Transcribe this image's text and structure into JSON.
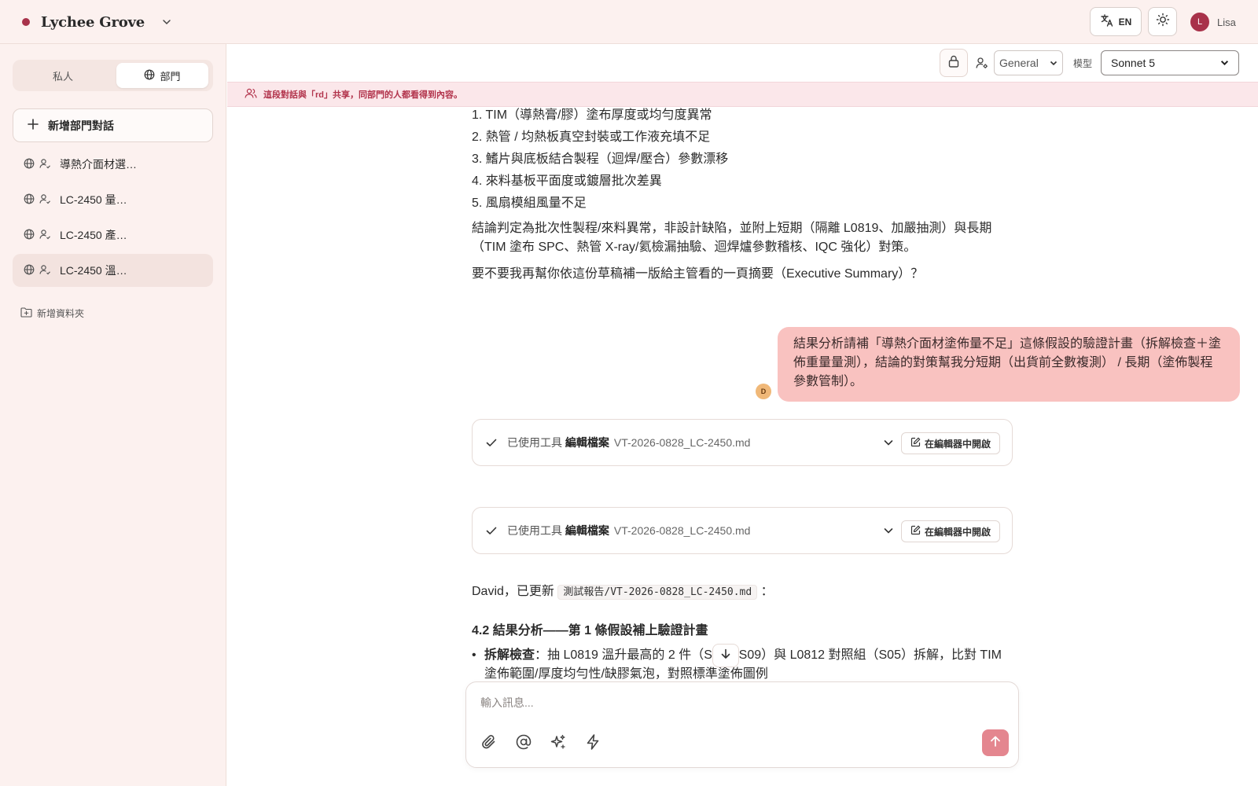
{
  "app": {
    "name": "Lychee Grove",
    "brand_color": "#a8324a",
    "lang_label": "EN",
    "user_initial": "L",
    "user_name": "Lisa"
  },
  "sidebar": {
    "tabs": {
      "private": "私人",
      "department": "部門"
    },
    "new_dept_conversation": "新增部門對話",
    "conversations": [
      {
        "label": "導熱介面材選…",
        "active": false
      },
      {
        "label": "LC-2450 量…",
        "active": false
      },
      {
        "label": "LC-2450 產…",
        "active": false
      },
      {
        "label": "LC-2450 溫…",
        "active": true
      }
    ],
    "new_folder": "新增資料夾"
  },
  "header": {
    "persona_value": "General",
    "model_label": "模型",
    "model_value": "Sonnet 5"
  },
  "banner": {
    "text": "這段對話與「rd」共享，同部門的人都看得到內容。"
  },
  "chat": {
    "list_items": [
      "1. TIM（導熱膏/膠）塗布厚度或均勻度異常",
      "2. 熱管 / 均熱板真空封裝或工作液充填不足",
      "3. 鰭片與底板結合製程（迴焊/壓合）參數漂移",
      "4. 來料基板平面度或鍍層批次差異",
      "5. 風扇模組風量不足"
    ],
    "conclusion_line1": "結論判定為批次性製程/來料異常，非設計缺陷，並附上短期（隔離 L0819、加嚴抽測）與長期",
    "conclusion_line2": "（TIM 塗布 SPC、熱管 X-ray/氦檢漏抽驗、迴焊爐參數稽核、IQC 強化）對策。",
    "question": "要不要我再幫你依這份草稿補一版給主管看的一頁摘要（Executive Summary）？",
    "user_message": "結果分析請補「導熱介面材塗佈量不足」這條假設的驗證計畫（拆解檢查＋塗佈重量量測），結論的對策幫我分短期（出貨前全數複測） / 長期（塗佈製程參數管制）。",
    "user_avatar_initial": "D",
    "tool_cards": [
      {
        "prefix": "已使用工具",
        "tool": "編輯檔案",
        "file": "VT-2026-0828_LC-2450.md",
        "open_label": "在編輯器中開啟"
      },
      {
        "prefix": "已使用工具",
        "tool": "編輯檔案",
        "file": "VT-2026-0828_LC-2450.md",
        "open_label": "在編輯器中開啟"
      }
    ],
    "update_prefix": "David，已更新",
    "update_file": "測試報告/VT-2026-0828_LC-2450.md",
    "update_suffix": "：",
    "section_heading": "4.2 結果分析——第 1 條假設補上驗證計畫",
    "bullet_bold": "拆解檢查",
    "bullet_line1": "：抽 L0819 溫升最高的 2 件（S04、S09）與 L0812 對照組（S05）拆解，比對 TIM",
    "bullet_line2": "塗佈範圍/厚度均勻性/缺膠氣泡，對照標準塗佈圖例"
  },
  "composer": {
    "placeholder": "輸入訊息..."
  }
}
